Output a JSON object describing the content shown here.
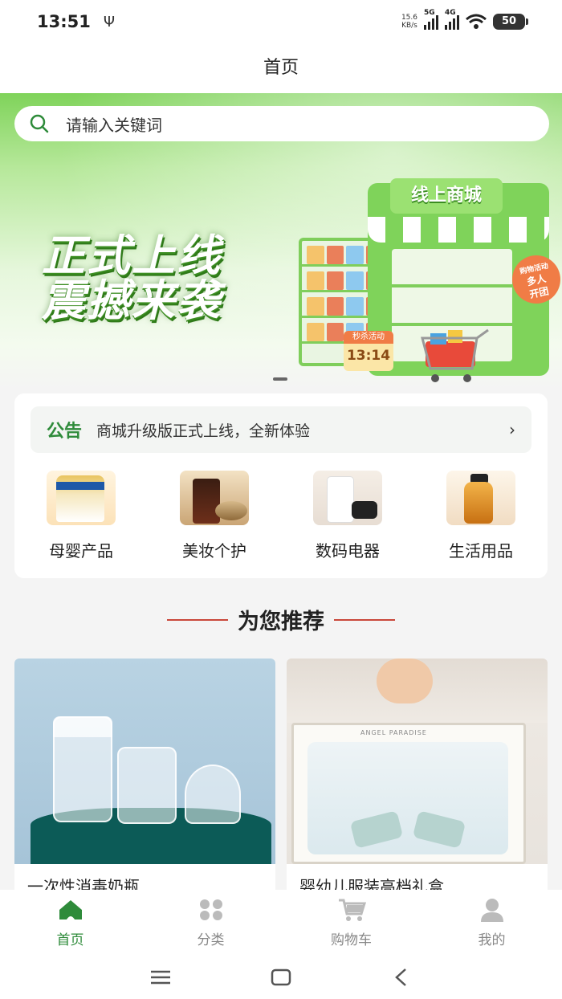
{
  "status_bar": {
    "time": "13:51",
    "net_speed_value": "15.6",
    "net_speed_unit": "KB/s",
    "signal1_label": "5G",
    "signal2_label": "4G",
    "battery": "50"
  },
  "header": {
    "title": "首页"
  },
  "search": {
    "placeholder": "请输入关键词"
  },
  "banner": {
    "headline_line1": "正式上线",
    "headline_line2": "震撼来袭",
    "store_sign": "线上商城",
    "timer_label": "秒杀活动",
    "timer_time": "13:14",
    "badge_line1": "购物活动",
    "badge_line2": "多人",
    "badge_line3": "开团"
  },
  "notice": {
    "label": "公告",
    "text": "商城升级版正式上线，全新体验",
    "arrow": "›"
  },
  "categories": [
    {
      "label": "母婴产品",
      "icon": "baby-formula-icon"
    },
    {
      "label": "美妆个护",
      "icon": "cosmetics-icon"
    },
    {
      "label": "数码电器",
      "icon": "appliance-icon"
    },
    {
      "label": "生活用品",
      "icon": "daily-goods-icon"
    }
  ],
  "recommend": {
    "title": "为您推荐"
  },
  "products": [
    {
      "name": "一次性消毒奶瓶"
    },
    {
      "name": "婴幼儿服装高档礼盒",
      "brand_text": "ANGEL PARADISE"
    }
  ],
  "tabbar": {
    "items": [
      {
        "label": "首页",
        "icon": "home-icon",
        "active": true
      },
      {
        "label": "分类",
        "icon": "category-icon",
        "active": false
      },
      {
        "label": "购物车",
        "icon": "cart-icon",
        "active": false
      },
      {
        "label": "我的",
        "icon": "profile-icon",
        "active": false
      }
    ]
  },
  "colors": {
    "accent_green": "#2e8b3a",
    "banner_green": "#7fd35a",
    "divider_red": "#c9473a"
  }
}
